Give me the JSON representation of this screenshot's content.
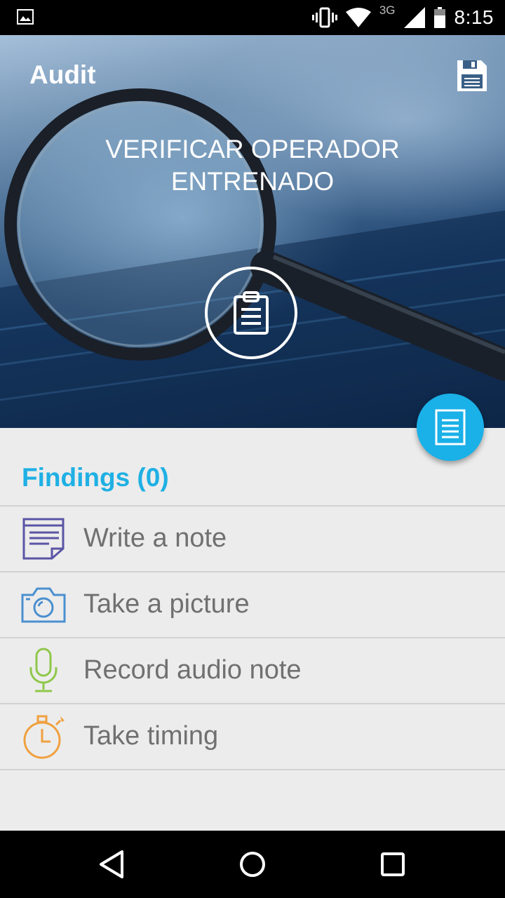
{
  "status_bar": {
    "time": "8:15",
    "network": "3G"
  },
  "appbar": {
    "title": "Audit"
  },
  "hero": {
    "title": "VERIFICAR OPERADOR ENTRENADO"
  },
  "findings": {
    "header": "Findings (0)"
  },
  "actions": [
    {
      "label": "Write a note",
      "icon": "note-icon",
      "color": "#5a55a5"
    },
    {
      "label": "Take a picture",
      "icon": "camera-icon",
      "color": "#4a8fcf"
    },
    {
      "label": "Record audio note",
      "icon": "microphone-icon",
      "color": "#8fc74a"
    },
    {
      "label": "Take timing",
      "icon": "stopwatch-icon",
      "color": "#f0a040"
    }
  ],
  "colors": {
    "accent": "#1fb0e4",
    "fab": "#1ab0e8",
    "text_secondary": "#707070"
  }
}
